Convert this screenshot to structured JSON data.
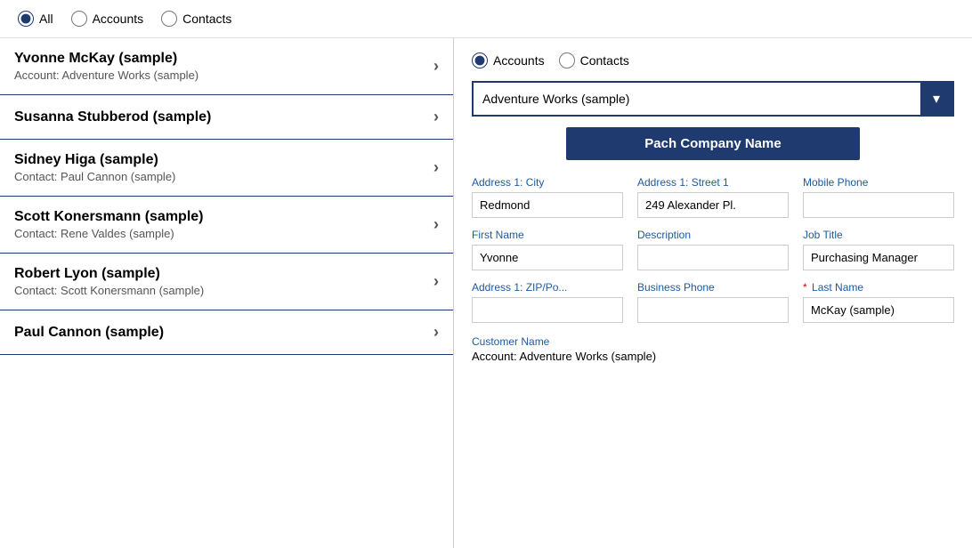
{
  "topBar": {
    "filters": [
      {
        "id": "all",
        "label": "All",
        "checked": true
      },
      {
        "id": "accounts",
        "label": "Accounts",
        "checked": false
      },
      {
        "id": "contacts",
        "label": "Contacts",
        "checked": false
      }
    ]
  },
  "listItems": [
    {
      "name": "Yvonne McKay (sample)",
      "sub": "Account: Adventure Works (sample)"
    },
    {
      "name": "Susanna Stubberod (sample)",
      "sub": ""
    },
    {
      "name": "Sidney Higa (sample)",
      "sub": "Contact: Paul Cannon (sample)"
    },
    {
      "name": "Scott Konersmann (sample)",
      "sub": "Contact: Rene Valdes (sample)"
    },
    {
      "name": "Robert Lyon (sample)",
      "sub": "Contact: Scott Konersmann (sample)"
    },
    {
      "name": "Paul Cannon (sample)",
      "sub": ""
    }
  ],
  "detail": {
    "radioFilters": [
      {
        "id": "det-accounts",
        "label": "Accounts",
        "checked": true
      },
      {
        "id": "det-contacts",
        "label": "Contacts",
        "checked": false
      }
    ],
    "dropdownValue": "Adventure Works (sample)",
    "dropdownIcon": "▾",
    "patchButtonLabel": "Pach Company Name",
    "fields": [
      {
        "label": "Address 1: City",
        "value": "Redmond",
        "required": false,
        "id": "city"
      },
      {
        "label": "Address 1: Street 1",
        "value": "249 Alexander Pl.",
        "required": false,
        "id": "street1"
      },
      {
        "label": "Mobile Phone",
        "value": "",
        "required": false,
        "id": "mobile"
      },
      {
        "label": "First Name",
        "value": "Yvonne",
        "required": false,
        "id": "firstname"
      },
      {
        "label": "Description",
        "value": "",
        "required": false,
        "id": "description"
      },
      {
        "label": "Job Title",
        "value": "Purchasing Manager",
        "required": false,
        "id": "jobtitle"
      },
      {
        "label": "Address 1: ZIP/Po...",
        "value": "",
        "required": false,
        "id": "zip"
      },
      {
        "label": "Business Phone",
        "value": "",
        "required": false,
        "id": "bizphone"
      },
      {
        "label": "Last Name",
        "value": "McKay (sample)",
        "required": true,
        "id": "lastname"
      }
    ],
    "customerNameLabel": "Customer Name",
    "customerNameValue": "Account: Adventure Works (sample)"
  }
}
